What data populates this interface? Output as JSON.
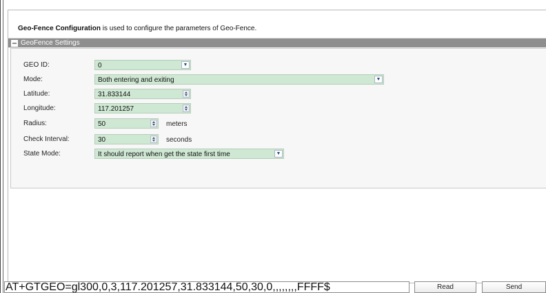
{
  "description": {
    "bold": "Geo-Fence Configuration",
    "rest": " is used to configure the parameters of Geo-Fence."
  },
  "section": {
    "title": "GeoFence Settings"
  },
  "fields": {
    "geo_id": {
      "label": "GEO ID:",
      "value": "0"
    },
    "mode": {
      "label": "Mode:",
      "value": "Both entering and exiting"
    },
    "latitude": {
      "label": "Latitude:",
      "value": "31.833144"
    },
    "longitude": {
      "label": "Longitude:",
      "value": "117.201257"
    },
    "radius": {
      "label": "Radius:",
      "value": "50",
      "unit": "meters"
    },
    "check_interval": {
      "label": "Check Interval:",
      "value": "30",
      "unit": "seconds"
    },
    "state_mode": {
      "label": "State Mode:",
      "value": "It should report when get the state first time"
    }
  },
  "command": "AT+GTGEO=gl300,0,3,117.201257,31.833144,50,30,0,,,,,,,,FFFF$",
  "buttons": {
    "read": "Read",
    "send": "Send"
  },
  "colors": {
    "field_bg": "#cfe8d3",
    "header_bg": "#8e8e8e"
  }
}
